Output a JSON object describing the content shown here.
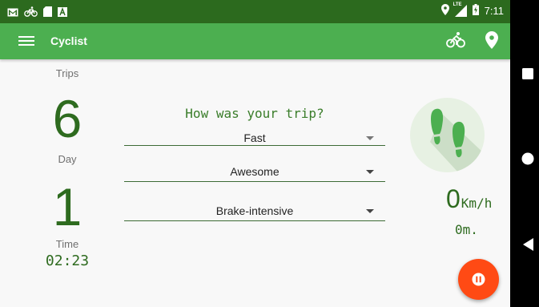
{
  "status_bar": {
    "left_icons": [
      "gmail-icon",
      "bike-icon",
      "sd-card-icon",
      "app-a-icon"
    ],
    "right_icons": [
      "location-icon",
      "lte-signal-icon",
      "battery-icon"
    ],
    "lte_label": "LTE",
    "time": "7:11"
  },
  "app_bar": {
    "title": "Cyclist",
    "actions": [
      "bike-icon",
      "location-icon"
    ]
  },
  "stats": {
    "trips_label": "Trips",
    "trips_value": "6",
    "day_label": "Day",
    "day_value": "1",
    "time_label": "Time",
    "time_value": "02:23"
  },
  "survey": {
    "question": "How was your trip?",
    "speed_selected": "Fast",
    "rating_selected": "Awesome",
    "braking_selected": "Brake-intensive"
  },
  "activity": {
    "icon": "footsteps-icon",
    "speed_value": "0",
    "speed_unit": "Km/h",
    "distance": "0m."
  },
  "fab": {
    "icon": "pause-icon"
  },
  "nav_bar": {
    "icons": [
      "recents-icon",
      "home-icon",
      "back-icon"
    ]
  },
  "colors": {
    "status_bar": "#2c6a1e",
    "app_bar": "#4caf50",
    "accent_text": "#2e6b1f",
    "fab": "#ff4a14",
    "background": "#f8f8f8"
  }
}
